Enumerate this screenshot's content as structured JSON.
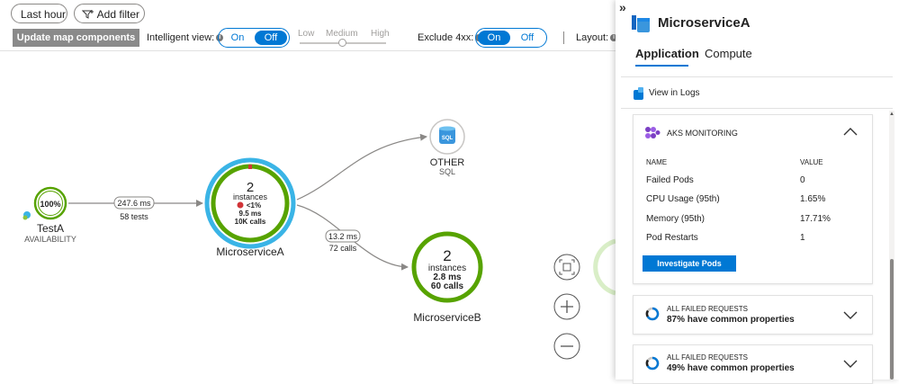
{
  "toolbar": {
    "time_range": "Last hour",
    "add_filter": "Add filter",
    "update_map": "Update map components",
    "intelligent_view_label": "Intelligent view:",
    "on": "On",
    "off": "Off",
    "slider_low": "Low",
    "slider_medium": "Medium",
    "slider_high": "High",
    "exclude_4xx_label": "Exclude 4xx:",
    "layout_label": "Layout:"
  },
  "graph": {
    "testA": {
      "pct": "100%",
      "name": "TestA",
      "sub": "AVAILABILITY"
    },
    "edge_test": {
      "duration": "247.6 ms",
      "count": "58 tests"
    },
    "msA": {
      "count": "2",
      "instances": "instances",
      "fail": "<1%",
      "duration": "9.5 ms",
      "calls": "10K calls",
      "name": "MicroserviceA"
    },
    "other": {
      "name": "OTHER",
      "sub": "SQL",
      "icon_text": "SQL"
    },
    "edge_b": {
      "duration": "13.2 ms",
      "count": "72 calls"
    },
    "msB": {
      "count": "2",
      "instances": "instances",
      "duration": "2.8 ms",
      "calls": "60 calls",
      "name": "MicroserviceB"
    }
  },
  "panel": {
    "title": "MicroserviceA",
    "tabs": [
      "Application",
      "Compute"
    ],
    "view_in_logs": "View in Logs",
    "aks": {
      "title": "AKS MONITORING",
      "col_name": "NAME",
      "col_value": "VALUE",
      "rows": [
        {
          "name": "Failed Pods",
          "value": "0"
        },
        {
          "name": "CPU Usage (95th)",
          "value": "1.65%"
        },
        {
          "name": "Memory (95th)",
          "value": "17.71%"
        },
        {
          "name": "Pod Restarts",
          "value": "1"
        }
      ],
      "button": "Investigate Pods"
    },
    "failed_cards": [
      {
        "title": "ALL FAILED REQUESTS",
        "detail": "87% have common properties"
      },
      {
        "title": "ALL FAILED REQUESTS",
        "detail": "49% have common properties"
      }
    ]
  },
  "colors": {
    "accent": "#0078d4",
    "healthy": "#57a300",
    "selected": "#3ab4e6",
    "error": "#d13438"
  }
}
